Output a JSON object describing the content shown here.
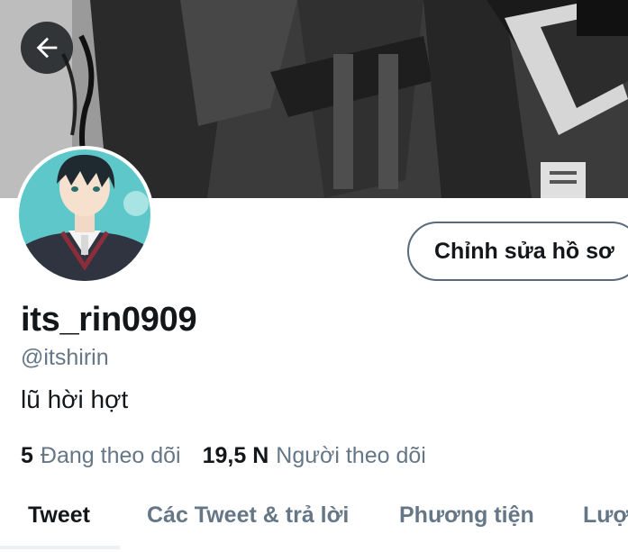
{
  "header": {
    "back_icon": "arrow-left-icon",
    "banner_colors": {
      "dark": "#2b2b2b",
      "mid": "#5c5c5c",
      "light": "#d9d9d9"
    }
  },
  "profile": {
    "display_name": "its_rin0909",
    "handle": "@itshirin",
    "bio": "lũ hời hợt",
    "edit_button_label": "Chỉnh sửa hồ sơ",
    "avatar_bg": "#5ec7c9"
  },
  "stats": {
    "following_count": "5",
    "following_label": "Đang theo dõi",
    "followers_count": "19,5 N",
    "followers_label": "Người theo dõi"
  },
  "tabs": [
    {
      "label": "Tweet",
      "active": true
    },
    {
      "label": "Các Tweet & trả lời",
      "active": false
    },
    {
      "label": "Phương tiện",
      "active": false
    },
    {
      "label": "Lượt thích",
      "active": false
    }
  ],
  "colors": {
    "primary_text": "#14171a",
    "secondary_text": "#657786",
    "border": "#5a6a78"
  }
}
